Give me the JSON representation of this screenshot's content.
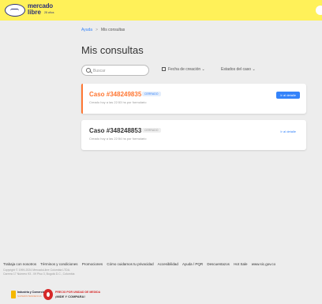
{
  "header": {
    "logo_line1": "mercado",
    "logo_line2": "libre",
    "logo_sub": "28 años"
  },
  "breadcrumb": {
    "items": [
      "Ayuda",
      "Mis consultas"
    ],
    "separator": ">"
  },
  "page": {
    "title": "Mis consultas"
  },
  "filters": {
    "search_placeholder": "Buscar",
    "date_label": "Fecha de creación",
    "state_label": "Estados del caso"
  },
  "cases": [
    {
      "title": "Caso #348249835",
      "badge": "Cerrado",
      "subtitle": "Creado hoy a las 22:53 hs por formulario",
      "button": "Ir al detalle"
    },
    {
      "title": "Caso #348248853",
      "badge": "Cerrado",
      "subtitle": "Creado hoy a las 22:54 hs por formulario",
      "button": "Ir al detalle"
    }
  ],
  "footer": {
    "links": [
      "Trabaja con nosotros",
      "Términos y condiciones",
      "Promociones",
      "Cómo cuidamos tu privacidad",
      "Accesibilidad",
      "Ayuda / PQR",
      "Descuentazos",
      "Hot Sale",
      "www.sic.gov.co"
    ],
    "copyright": "Copyright © 1999-2024 MercadoLibre Colombia LTDA.",
    "address": "Carrera 17 Número 93 - 09 Piso 3, Bogotá D.C., Colombia"
  },
  "badges": {
    "sic_line1": "Industria y Comercio",
    "sic_line2": "SUPERINTENDENCIA",
    "price_line1": "PRECIO POR UNIDAD DE MEDIDA",
    "price_line2": "¡MIDE Y COMPARA!"
  },
  "colors": {
    "topbar": "#fff159",
    "accent": "#3483fa",
    "highlight": "#ff7733"
  }
}
